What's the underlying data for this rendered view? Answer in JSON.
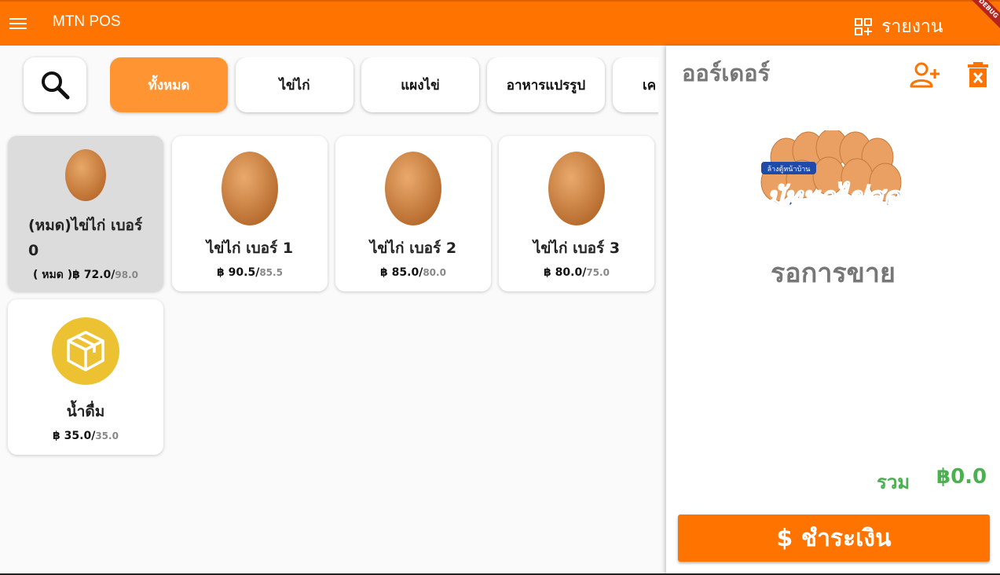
{
  "appbar": {
    "title": "MTN POS",
    "report_label": "รายงาน",
    "debug_label": "DEBUG",
    "color": "#ff7400"
  },
  "categories": [
    {
      "label": "ทั้งหมด",
      "active": true
    },
    {
      "label": "ไข่ไก่",
      "active": false
    },
    {
      "label": "แผงไข่",
      "active": false
    },
    {
      "label": "อาหารแปรรูป",
      "active": false
    },
    {
      "label": "เค",
      "active": false
    }
  ],
  "products": [
    {
      "name_line1": "(หมด)ไข่ไก่ เบอร์",
      "name_line2": "0",
      "prefix": "( หมด )",
      "price": "฿ 72.0/",
      "old_price": "98.0",
      "icon": "egg-icon",
      "sold_out": true
    },
    {
      "name": "ไข่ไก่ เบอร์ 1",
      "price": "฿ 90.5/",
      "old_price": "85.5",
      "icon": "egg-icon"
    },
    {
      "name": "ไข่ไก่ เบอร์ 2",
      "price": "฿ 85.0/",
      "old_price": "80.0",
      "icon": "egg-icon"
    },
    {
      "name": "ไข่ไก่ เบอร์ 3",
      "price": "฿ 80.0/",
      "old_price": "75.0",
      "icon": "egg-icon"
    },
    {
      "name": "น้ำดื่ม",
      "price": "฿ 35.0/",
      "old_price": "35.0",
      "icon": "box-icon"
    }
  ],
  "order": {
    "title": "ออร์เดอร์",
    "logo_text": "มัทนาไข่สด",
    "logo_subtext": "ล้างตู้หน้าบ้าน",
    "status": "รอการขาย",
    "total_label": "รวม",
    "total_value": "฿0.0",
    "pay_label": "$ ชำระเงิน",
    "accent": "#4caf50"
  }
}
